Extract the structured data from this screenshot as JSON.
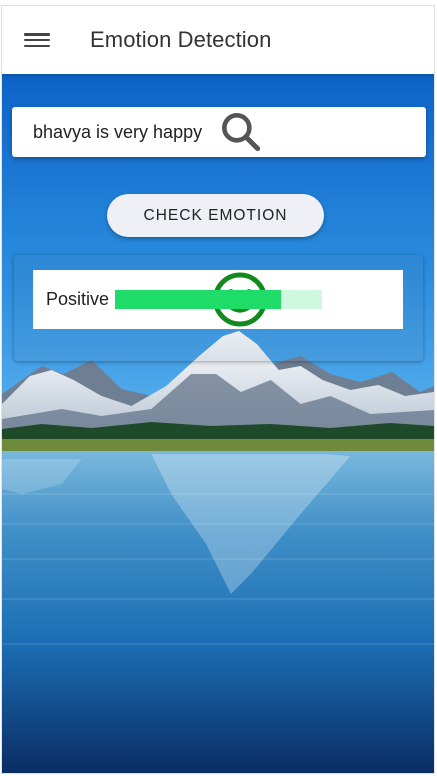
{
  "app": {
    "title": "Emotion Detection",
    "menu_icon": "hamburger-menu-icon"
  },
  "search": {
    "icon": "search-icon",
    "value": "bhavya is very happy"
  },
  "check_button": {
    "label": "CHECK EMOTION"
  },
  "result": {
    "icon": "smiley-face-icon",
    "label": "Positive",
    "score": 0.8,
    "colors": {
      "icon": "#128a1e",
      "fill": "#1fdc68",
      "track": "#d0f7df"
    }
  }
}
